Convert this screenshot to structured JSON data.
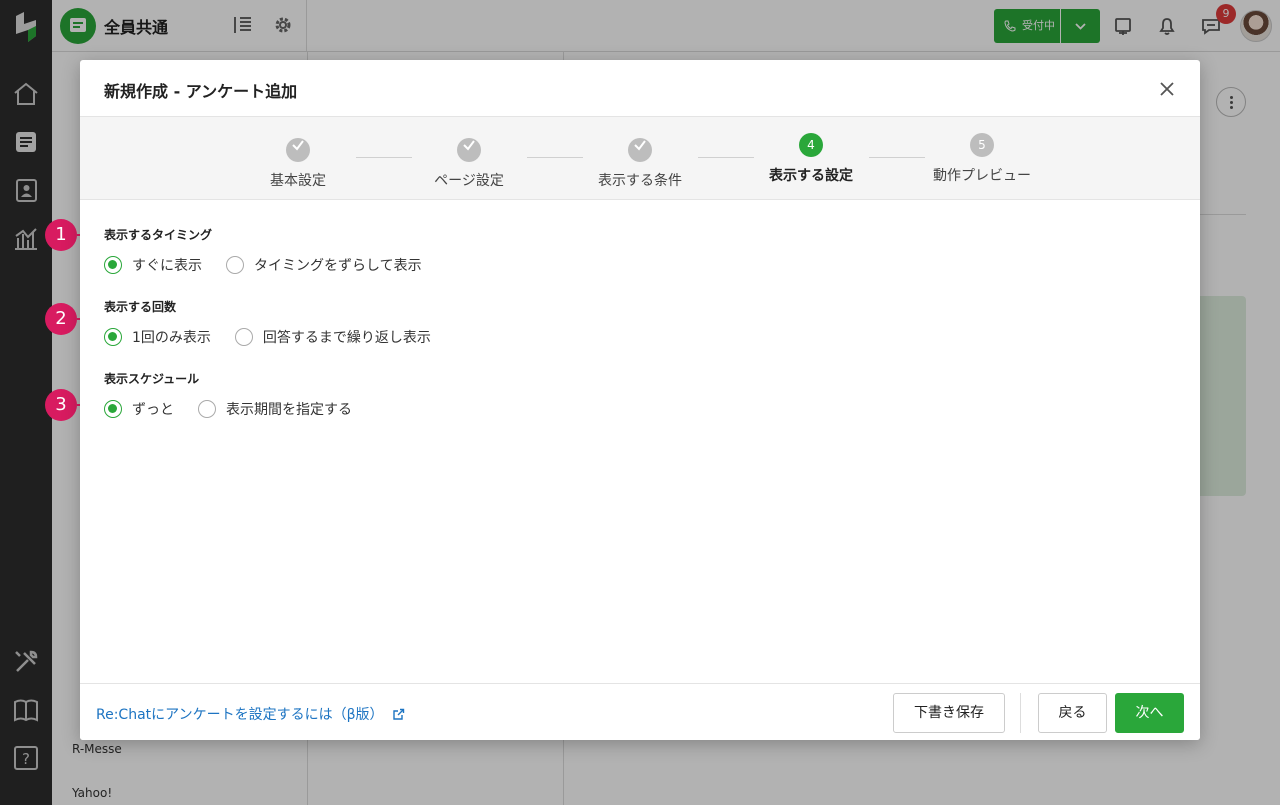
{
  "app": {
    "workspace_name": "全員共通",
    "reception_status": "受付中",
    "notification_count": "9",
    "accent_color": "#2aa73a",
    "marker_color": "#d81b60"
  },
  "sidebar_bg_items": {
    "item_1": "R-Messe",
    "item_2": "Yahoo!"
  },
  "modal": {
    "title": "新規作成 - アンケート追加",
    "steps": [
      {
        "num": "1",
        "label": "基本設定",
        "state": "done"
      },
      {
        "num": "2",
        "label": "ページ設定",
        "state": "done"
      },
      {
        "num": "3",
        "label": "表示する条件",
        "state": "done"
      },
      {
        "num": "4",
        "label": "表示する設定",
        "state": "active"
      },
      {
        "num": "5",
        "label": "動作プレビュー",
        "state": "todo"
      }
    ],
    "sections": [
      {
        "marker": "1",
        "label": "表示するタイミング",
        "options": [
          {
            "label": "すぐに表示",
            "checked": true
          },
          {
            "label": "タイミングをずらして表示",
            "checked": false
          }
        ]
      },
      {
        "marker": "2",
        "label": "表示する回数",
        "options": [
          {
            "label": "1回のみ表示",
            "checked": true
          },
          {
            "label": "回答するまで繰り返し表示",
            "checked": false
          }
        ]
      },
      {
        "marker": "3",
        "label": "表示スケジュール",
        "options": [
          {
            "label": "ずっと",
            "checked": true
          },
          {
            "label": "表示期間を指定する",
            "checked": false
          }
        ]
      }
    ],
    "footer": {
      "help_link": "Re:Chatにアンケートを設定するには（β版）",
      "draft_button": "下書き保存",
      "back_button": "戻る",
      "next_button": "次へ"
    }
  }
}
